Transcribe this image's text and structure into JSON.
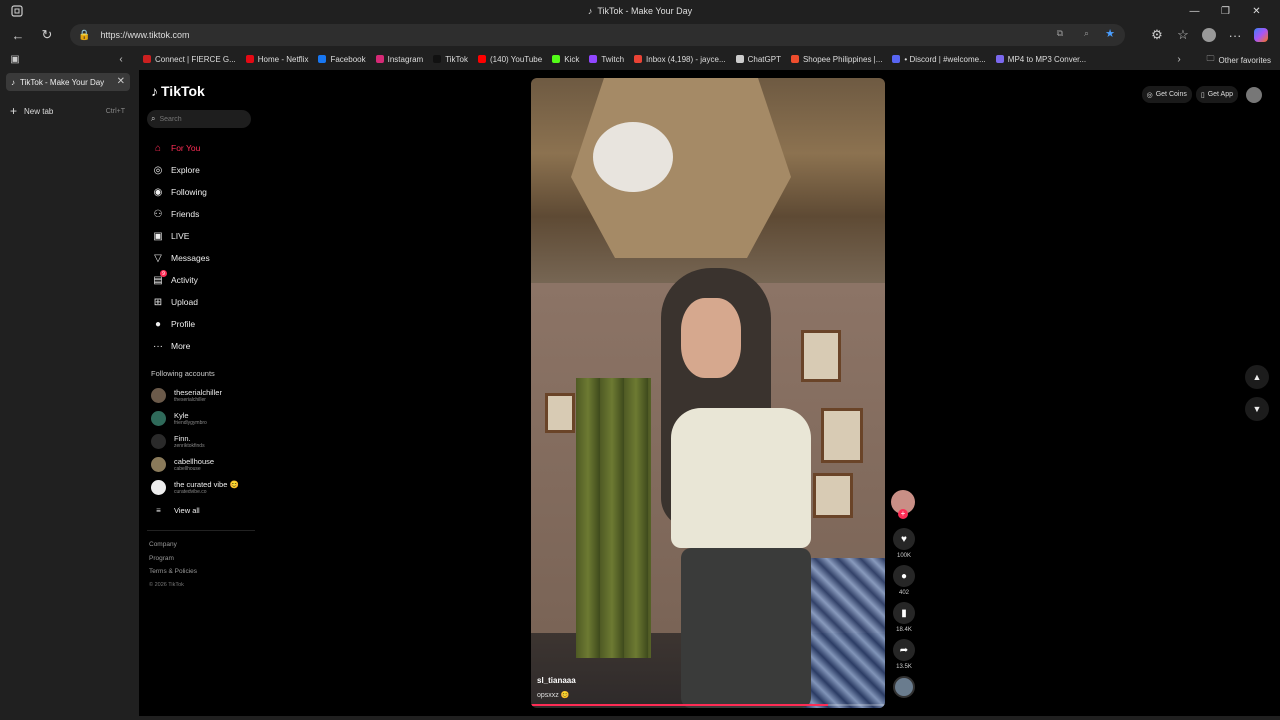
{
  "window": {
    "title": "TikTok - Make Your Day",
    "minimize": "—",
    "restore": "❐",
    "close": "✕"
  },
  "address_bar": {
    "url": "https://www.tiktok.com"
  },
  "favorites": [
    {
      "label": "Connect | FIERCE G...",
      "color": "#cc2020"
    },
    {
      "label": "Home - Netflix",
      "color": "#e50914"
    },
    {
      "label": "Facebook",
      "color": "#1877f2"
    },
    {
      "label": "Instagram",
      "color": "#d62976"
    },
    {
      "label": "TikTok",
      "color": "#111111"
    },
    {
      "label": "(140) YouTube",
      "color": "#ff0000"
    },
    {
      "label": "Kick",
      "color": "#53fc18"
    },
    {
      "label": "Twitch",
      "color": "#9146ff"
    },
    {
      "label": "Inbox (4,198) - jayce...",
      "color": "#ea4335"
    },
    {
      "label": "ChatGPT",
      "color": "#cccccc"
    },
    {
      "label": "Shopee Philippines |...",
      "color": "#ee4d2d"
    },
    {
      "label": "• Discord | #welcome...",
      "color": "#5865f2"
    },
    {
      "label": "MP4 to MP3 Conver...",
      "color": "#7b68ee"
    }
  ],
  "other_favorites": "Other favorites",
  "browser_tabs": {
    "active_tab": "TikTok - Make Your Day",
    "new_tab": "New tab",
    "new_tab_shortcut": "Ctrl+T"
  },
  "tiktok": {
    "logo": "TikTok",
    "search_placeholder": "Search",
    "nav": [
      {
        "label": "For You",
        "icon": "home-icon",
        "glyph": "⌂",
        "active": true
      },
      {
        "label": "Explore",
        "icon": "compass-icon",
        "glyph": "◎",
        "active": false
      },
      {
        "label": "Following",
        "icon": "following-icon",
        "glyph": "◉",
        "active": false
      },
      {
        "label": "Friends",
        "icon": "friends-icon",
        "glyph": "⚇",
        "active": false
      },
      {
        "label": "LIVE",
        "icon": "live-icon",
        "glyph": "▣",
        "active": false
      },
      {
        "label": "Messages",
        "icon": "messages-icon",
        "glyph": "▽",
        "active": false
      },
      {
        "label": "Activity",
        "icon": "activity-icon",
        "glyph": "▤",
        "active": false,
        "badge": "9"
      },
      {
        "label": "Upload",
        "icon": "upload-icon",
        "glyph": "⊞",
        "active": false
      },
      {
        "label": "Profile",
        "icon": "profile-icon",
        "glyph": "●",
        "active": false
      },
      {
        "label": "More",
        "icon": "more-icon",
        "glyph": "···",
        "active": false
      }
    ],
    "following_title": "Following accounts",
    "following": [
      {
        "name": "theserialchiller",
        "handle": "theserialchiller",
        "color": "#6b5a4a"
      },
      {
        "name": "Kyle",
        "handle": "friendlygymbro",
        "color": "#2f6a5a"
      },
      {
        "name": "Finn.",
        "handle": "zenriktokfinds",
        "color": "#2a2a2a"
      },
      {
        "name": "cabellhouse",
        "handle": "cabellhouse",
        "color": "#8a7a5a"
      },
      {
        "name": "the curated vibe 😊",
        "handle": "curatedvibe.co",
        "color": "#eeeeee"
      }
    ],
    "view_all": "View all",
    "footer": {
      "company": "Company",
      "program": "Program",
      "terms": "Terms & Policies",
      "copyright": "© 2026 TikTok"
    },
    "video": {
      "username": "sl_tianaaa",
      "caption": "opsxxz 😊",
      "progress_percent": 84
    },
    "actions": {
      "likes": "100K",
      "comments": "402",
      "saves": "18.4K",
      "shares": "13.5K"
    },
    "top_right": {
      "get_coins": "Get Coins",
      "get_app": "Get App"
    }
  }
}
